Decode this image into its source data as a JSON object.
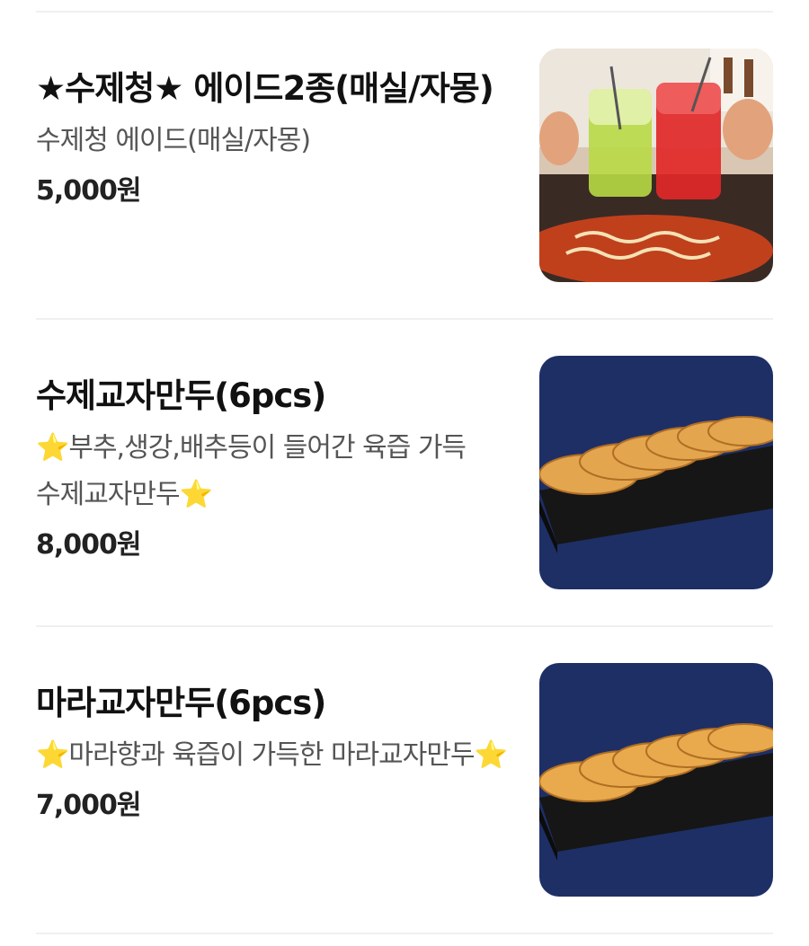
{
  "menu_items": [
    {
      "name": "★수제청★ 에이드2종(매실/자몽)",
      "description": "수제청 에이드(매실/자몽)",
      "price": "5,000원",
      "image": "ade-drinks-photo"
    },
    {
      "name": "수제교자만두(6pcs)",
      "description": "⭐부추,생강,배추등이 들어간 육즙 가득 수제교자만두⭐",
      "price": "8,000원",
      "image": "gyoza-photo"
    },
    {
      "name": "마라교자만두(6pcs)",
      "description": "⭐마라향과 육즙이 가득한 마라교자만두⭐",
      "price": "7,000원",
      "image": "mala-gyoza-photo"
    }
  ]
}
